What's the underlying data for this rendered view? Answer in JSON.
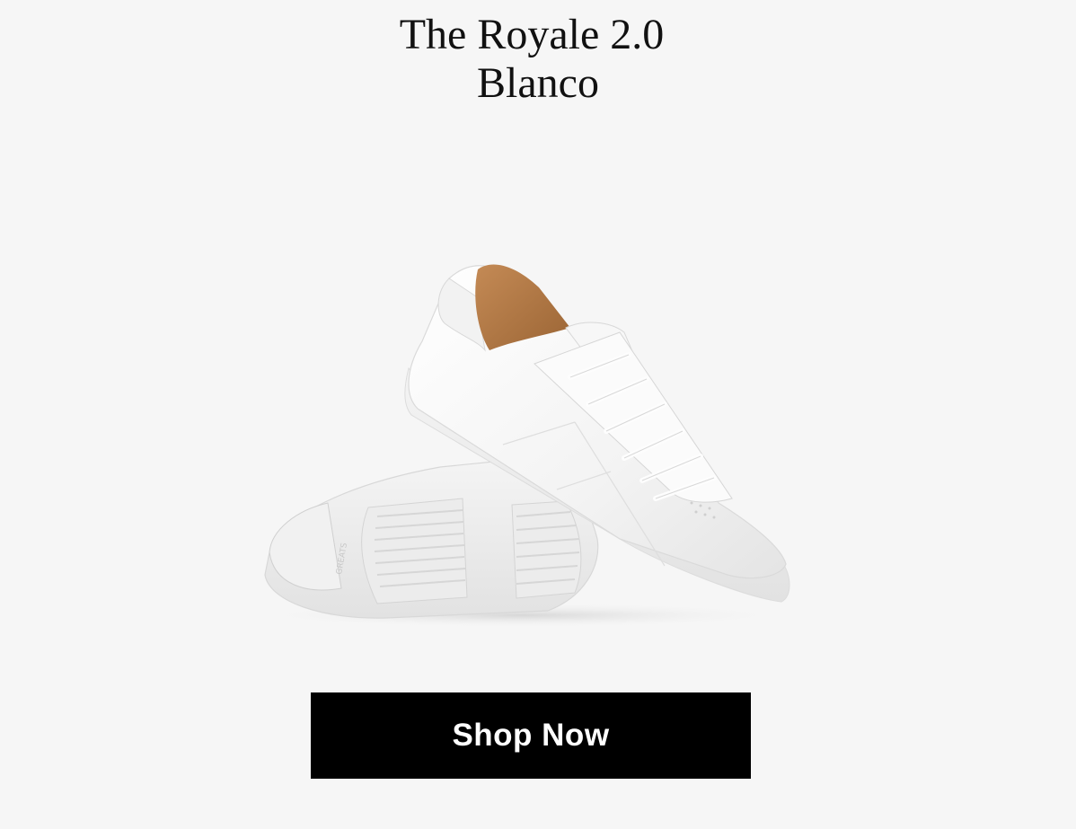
{
  "product": {
    "name": "The Royale 2.0",
    "colorway": "Blanco"
  },
  "image": {
    "subject": "sneaker-pair"
  },
  "cta": {
    "label": "Shop Now"
  },
  "colors": {
    "background": "#f6f6f6",
    "button": "#000000",
    "button_text": "#ffffff",
    "shoe_leather": "#fafafa",
    "lining": "#b57a45"
  }
}
